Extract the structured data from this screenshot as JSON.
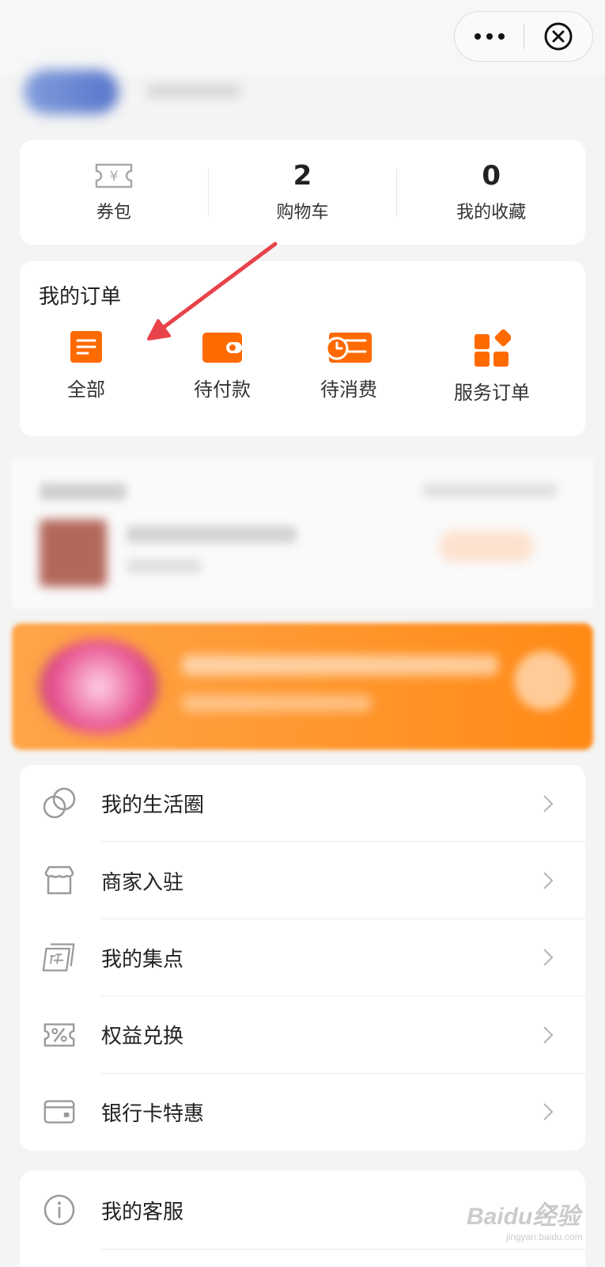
{
  "stats": {
    "coupon_label": "券包",
    "coupon_glyph": "¥",
    "cart_count": "2",
    "cart_label": "购物车",
    "fav_count": "0",
    "fav_label": "我的收藏"
  },
  "orders": {
    "title": "我的订单",
    "items": [
      {
        "label": "全部",
        "icon": "order-list-icon"
      },
      {
        "label": "待付款",
        "icon": "wallet-icon"
      },
      {
        "label": "待消费",
        "icon": "clock-ticket-icon"
      },
      {
        "label": "服务订单",
        "icon": "grid-icon"
      }
    ]
  },
  "menu": {
    "items": [
      {
        "label": "我的生活圈",
        "icon": "circles-icon"
      },
      {
        "label": "商家入驻",
        "icon": "store-icon"
      },
      {
        "label": "我的集点",
        "icon": "stamp-card-icon"
      },
      {
        "label": "权益兑换",
        "icon": "discount-ticket-icon"
      },
      {
        "label": "银行卡特惠",
        "icon": "bank-card-icon"
      }
    ]
  },
  "menu2": {
    "items": [
      {
        "label": "我的客服",
        "icon": "info-icon"
      }
    ]
  },
  "watermark": {
    "brand": "Baidu经验",
    "url": "jingyan.baidu.com"
  },
  "colors": {
    "accent": "#ff6a00",
    "arrow": "#e8434a",
    "background": "#f4f4f4"
  }
}
